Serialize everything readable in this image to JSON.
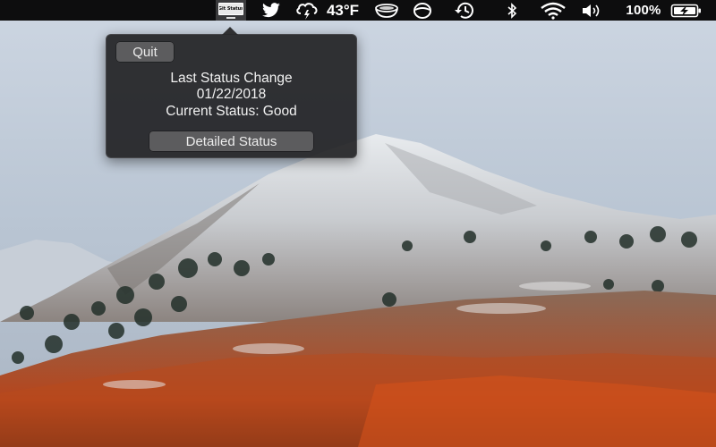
{
  "menubar": {
    "status_app_icon_label": "Git Status",
    "weather_temp": "43°F",
    "battery_percent": "100%",
    "icons": {
      "status_app": "monitor-icon",
      "twitter": "twitter-bird-icon",
      "weather": "thunderstorm-cloud-icon",
      "bowl": "bowl-icon",
      "circle_app": "circle-slash-icon",
      "time_machine": "time-machine-icon",
      "bluetooth": "bluetooth-icon",
      "wifi": "wifi-icon",
      "volume": "volume-icon",
      "battery": "battery-charging-icon"
    }
  },
  "popover": {
    "quit_label": "Quit",
    "line1": "Last Status Change",
    "line2": "01/22/2018",
    "line3": "Current Status: Good",
    "detailed_label": "Detailed Status"
  },
  "colors": {
    "menubar_bg": "#0d0d0e",
    "popover_bg": "#1e1e20",
    "button_bg": "#5c5c5e"
  }
}
